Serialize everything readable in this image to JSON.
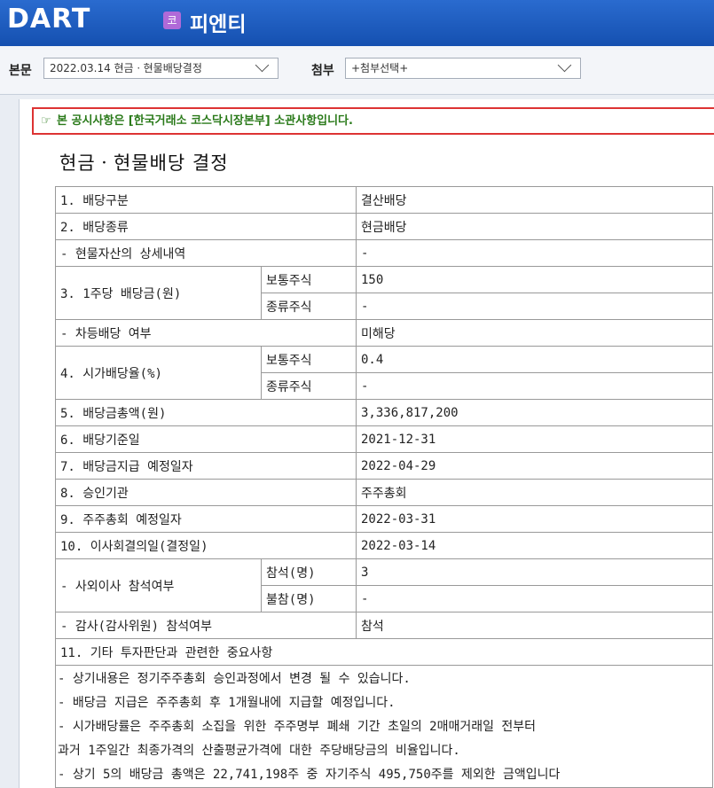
{
  "header": {
    "logo": "DART",
    "company_badge": "코",
    "company_name": "피엔티"
  },
  "selectors": {
    "main_label": "본문",
    "main_value": "2022.03.14  현금ㆍ현물배당결정",
    "attach_label": "첨부",
    "attach_value": "+첨부선택+"
  },
  "notice": {
    "icon": "pointing-hand-icon",
    "text": "본 공시사항은 [한국거래소 코스닥시장본부] 소관사항입니다."
  },
  "doc_title": "현금ㆍ현물배당 결정",
  "table": {
    "r1_label": "1. 배당구분",
    "r1_value": "결산배당",
    "r2_label": "2. 배당종류",
    "r2_value": "현금배당",
    "r3_label": "- 현물자산의 상세내역",
    "r3_value": "-",
    "r4_label": "3. 1주당 배당금(원)",
    "r4_sub1": "보통주식",
    "r4_val1": "150",
    "r4_sub2": "종류주식",
    "r4_val2": "-",
    "r5_label": "- 차등배당 여부",
    "r5_value": "미해당",
    "r6_label": "4. 시가배당율(%)",
    "r6_sub1": "보통주식",
    "r6_val1": "0.4",
    "r6_sub2": "종류주식",
    "r6_val2": "-",
    "r7_label": "5. 배당금총액(원)",
    "r7_value": "3,336,817,200",
    "r8_label": "6. 배당기준일",
    "r8_value": "2021-12-31",
    "r9_label": "7. 배당금지급 예정일자",
    "r9_value": "2022-04-29",
    "r10_label": "8. 승인기관",
    "r10_value": "주주총회",
    "r11_label": "9. 주주총회 예정일자",
    "r11_value": "2022-03-31",
    "r12_label": "10. 이사회결의일(결정일)",
    "r12_value": "2022-03-14",
    "r13_label": "- 사외이사 참석여부",
    "r13_sub1": "참석(명)",
    "r13_val1": "3",
    "r13_sub2": "불참(명)",
    "r13_val2": "-",
    "r14_label": "- 감사(감사위원) 참석여부",
    "r14_value": "참석",
    "r15_label": "11. 기타 투자판단과 관련한 중요사항",
    "notes": [
      "- 상기내용은 정기주주총회 승인과정에서 변경 될 수 있습니다.",
      "- 배당금 지급은 주주총회 후 1개월내에 지급할 예정입니다.",
      "- 시가배당률은 주주총회 소집을 위한 주주명부 폐쇄 기간 초일의 2매매거래일 전부터",
      "과거 1주일간 최종가격의 산출평균가격에 대한 주당배당금의 비율입니다.",
      "- 상기 5의 배당금 총액은 22,741,198주 중 자기주식 495,750주를 제외한 금액입니다"
    ]
  }
}
